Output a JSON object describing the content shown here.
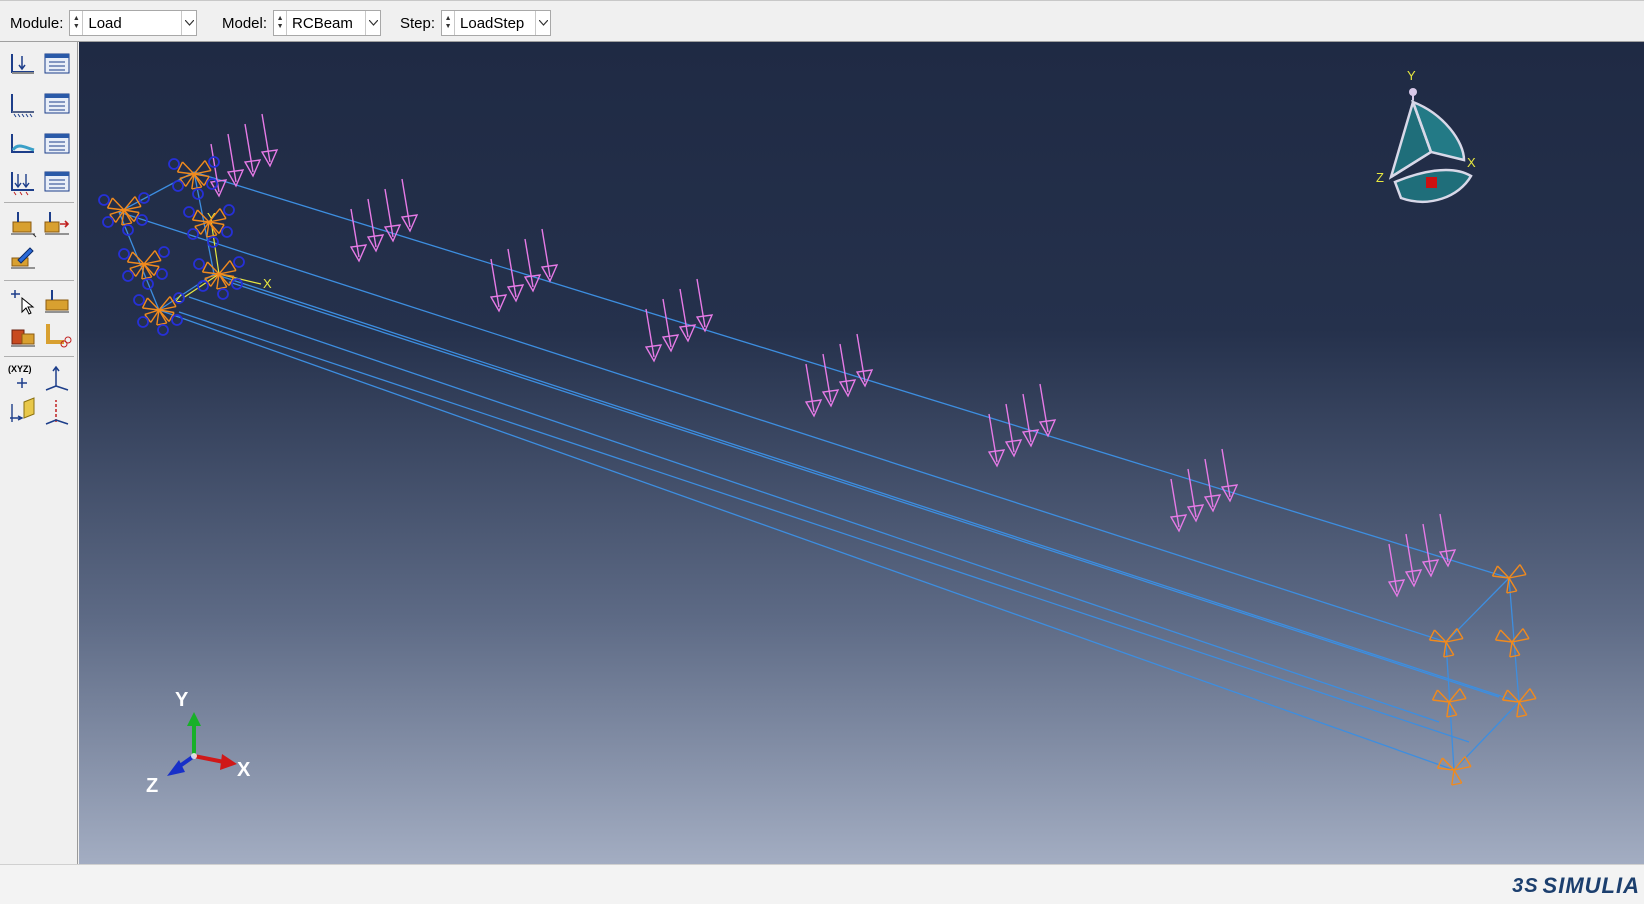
{
  "context_bar": {
    "module": {
      "label": "Module:",
      "value": "Load"
    },
    "model": {
      "label": "Model:",
      "value": "RCBeam"
    },
    "step": {
      "label": "Step:",
      "value": "LoadStep"
    }
  },
  "toolbox": {
    "tools": [
      {
        "name": "create-load-icon"
      },
      {
        "name": "load-manager-icon"
      },
      {
        "name": "create-bc-icon"
      },
      {
        "name": "bc-manager-icon"
      },
      {
        "name": "create-predefined-field-icon"
      },
      {
        "name": "predefined-field-manager-icon"
      },
      {
        "name": "create-load-case-icon"
      },
      {
        "name": "load-case-manager-icon"
      },
      {
        "name": "create-special-icon"
      },
      {
        "name": "special-manager-icon"
      },
      {
        "name": "edit-icon"
      },
      {
        "name": "query-icon"
      },
      {
        "name": "partition-icon"
      },
      {
        "name": "datum-icon"
      },
      {
        "name": "cut-icon"
      },
      {
        "name": "create-datum-point-icon"
      },
      {
        "name": "create-datum-csys-icon"
      },
      {
        "name": "create-datum-plane-icon"
      },
      {
        "name": "create-datum-axis-icon"
      }
    ],
    "xyz_label": "(XYZ)"
  },
  "viewport": {
    "local_triad": {
      "x": "X",
      "y": "Y",
      "z": "Z"
    },
    "global_triad": {
      "x": "X",
      "y": "Y",
      "z": "Z"
    },
    "view_cube": {
      "x": "X",
      "y": "Y",
      "z": "Z"
    },
    "colors": {
      "edges": "#3d8ee0",
      "loads": "#e67ae6",
      "bc_orange": "#f08a1e",
      "bc_blue": "#2630d6"
    }
  },
  "statusbar": {
    "brand": "SIMULIA",
    "brand_mark": "3S"
  }
}
